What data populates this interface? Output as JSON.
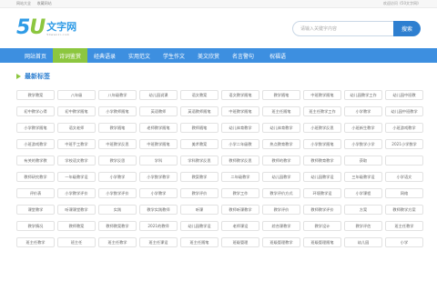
{
  "topbar": {
    "links": [
      "网站大全",
      "收藏网站"
    ],
    "welcome": "欢迎访问《50文字网》"
  },
  "logo": {
    "num_a": "5",
    "num_b": "U",
    "cn": "文字网",
    "en": "50wenzi.com"
  },
  "search": {
    "placeholder": "请输入关键字内容",
    "button": "搜索"
  },
  "nav": {
    "items": [
      "网站首页",
      "诗词鉴赏",
      "经典语录",
      "实用范文",
      "学生作文",
      "美文欣赏",
      "名言警句",
      "祝福语"
    ],
    "active": 1
  },
  "section": {
    "title": "最新标签"
  },
  "tags": [
    "教学教案",
    "八年级",
    "八年级教学",
    "幼儿园说课",
    "语文教案",
    "语文教学随笔",
    "教学随笔",
    "中班教学随笔",
    "幼儿园教学工作",
    "幼儿园中班教",
    "初中教学心得",
    "初中教学随笔",
    "小学教师随笔",
    "英语教师",
    "英语教师随笔",
    "中班教学随笔",
    "班主任随笔",
    "班主任教学工作",
    "小学教学",
    "幼儿园中班教学",
    "小学教学随笔",
    "语文老师",
    "教学随笔",
    "老师教学随笔",
    "教师随笔",
    "幼儿体育教学",
    "幼儿体育教学",
    "小班教学反思",
    "小班新生教学",
    "小班游戏教学",
    "小班游戏教学",
    "中班手工教学",
    "中班教学反思",
    "中班教学随笔",
    "美术教案",
    "小学二年级教",
    "热点教育教学",
    "小学数学随笔",
    "小学数学小学",
    "2021小学数学",
    "有关的教学教",
    "学校语文教学",
    "教学反思",
    "学科",
    "学科教学反思",
    "教师教学反思",
    "教师的教学",
    "教师教育教学",
    "获取",
    "",
    "教师研究教学",
    "一年级教学设",
    "小学教学",
    "小学数学教学",
    "教案教学",
    "二年级教学",
    "幼儿园教学",
    "幼儿园教学设",
    "三年级教学设",
    "小学语文",
    "评价表",
    "小学教学评价",
    "小学数学评价",
    "小学教学",
    "教学评价",
    "教学工作",
    "教学评价方式",
    "环境教学设",
    "小学课程",
    "网络",
    "课堂教学",
    "听课课堂教学",
    "实践",
    "教学实践教师",
    "听课",
    "教师听课教学",
    "教学评价",
    "教师教学评价",
    "方案",
    "教师教学方案",
    "教学情况",
    "教师教案",
    "教师教案教学",
    "2021的教师",
    "幼儿园教学设",
    "老师课设",
    "综合课教学",
    "教学设计",
    "教学评估",
    "班主任教学",
    "班主任教学",
    "班主任",
    "班主任教学",
    "班主任课设",
    "班主任随笔",
    "班级管理",
    "班级管理教学",
    "班级管理随笔",
    "幼儿园",
    "小学"
  ]
}
